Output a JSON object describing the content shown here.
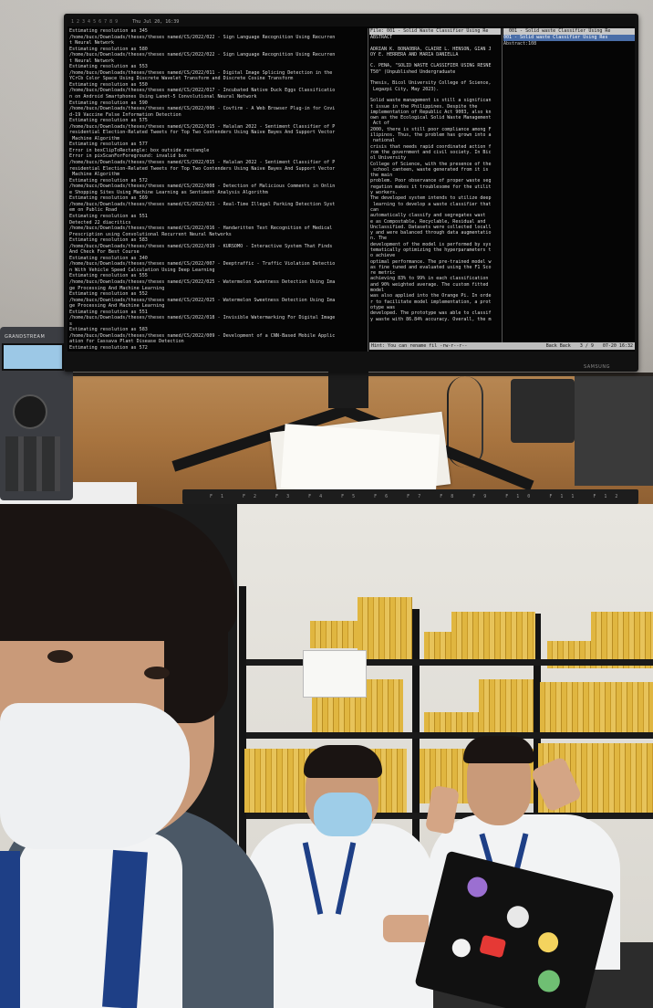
{
  "top_photo": {
    "phone_brand": "GRANDSTREAM",
    "monitor_brand": "SAMSUNG",
    "keyboard_keys": "F1 F2 F3 F4 F5 F6 F7 F8 F9 F10 F11 F12",
    "screen": {
      "workspaces": [
        "1",
        "2",
        "3",
        "4",
        "5",
        "6",
        "7",
        "8",
        "9"
      ],
      "active_workspace": "",
      "clock": "Thu Jul 20, 16:39",
      "terminal_lines": [
        "Estimating resolution as 345",
        "/home/bucs/Downloads/theses/theses named/CS/2022/022 - Sign Language Recognition Using Recurren",
        "t Neural Network",
        "Estimating resolution as 580",
        "/home/bucs/Downloads/theses/theses named/CS/2022/022 - Sign Language Recognition Using Recurren",
        "t Neural Network",
        "Estimating resolution as 553",
        "/home/bucs/Downloads/theses/theses named/CS/2022/011 - Digital Image Splicing Detection in the",
        "YCrCb Color Space Using Discrete Wavelet Transform and Discrete Cosine Transform",
        "Estimating resolution as 550",
        "/home/bucs/Downloads/theses/theses named/CS/2022/017 - Incubated Native Duck Eggs Classificatio",
        "n on Android Smartphones Using Lanet-5 Convolutional Neural Network",
        "Estimating resolution as 590",
        "/home/bucs/Downloads/theses/theses named/CS/2022/006 - Covfirm - A Web Browser Plug-in for Covi",
        "d-19 Vaccine False Information Detection",
        "Estimating resolution as 575",
        "/home/bucs/Downloads/theses/theses named/CS/2022/015 - Halalan 2022 - Sentiment Classifier of P",
        "residential Election-Related Tweets for Top Two Contenders Using Naive Bayes And Support Vector",
        " Machine Algorithm",
        "Estimating resolution as 577",
        "Error in boxClipToRectangle: box outside rectangle",
        "Error in pixScanForForeground: invalid box",
        "/home/bucs/Downloads/theses/theses named/CS/2022/015 - Halalan 2022 - Sentiment Classifier of P",
        "residential Election-Related Tweets for Top Two Contenders Using Naive Bayes And Support Vector",
        " Machine Algorithm",
        "Estimating resolution as 572",
        "/home/bucs/Downloads/theses/theses named/CS/2022/008 - Detection of Malicious Comments in Onlin",
        "e Shopping Sites Using Machine Learning as Sentiment Analysis Algorithm",
        "Estimating resolution as 569",
        "/home/bucs/Downloads/theses/theses named/CS/2022/021 - Real-Time Illegal Parking Detection Syst",
        "em on Public Road",
        "Estimating resolution as 551",
        "Detected 22 diacritics",
        "/home/bucs/Downloads/theses/theses named/CS/2022/016 - Handwritten Text Recognition of Medical",
        "Prescription using Convolutional Recurrent Neural Networks",
        "Estimating resolution as 583",
        "/home/bucs/Downloads/theses/theses named/CS/2022/019 - KURSOMO - Interactive System That Finds",
        "And Check For Best Course",
        "Estimating resolution as 340",
        "/home/bucs/Downloads/theses/theses named/CS/2022/007 - Deeptraffic - Traffic Violation Detectio",
        "n With Vehicle Speed Calculation Using Deep Learning",
        "Estimating resolution as 555",
        "/home/bucs/Downloads/theses/theses named/CS/2022/025 - Watermelon Sweetness Detection Using Ima",
        "ge Processing And Machine Learning",
        "Estimating resolution as 552",
        "/home/bucs/Downloads/theses/theses named/CS/2022/025 - Watermelon Sweetness Detection Using Ima",
        "ge Processing And Machine Learning",
        "Estimating resolution as 551",
        "/home/bucs/Downloads/theses/theses named/CS/2022/018 - Invisible Watermarking For Digital Image",
        "s",
        "Estimating resolution as 583",
        "/home/bucs/Downloads/theses/theses named/CS/2022/009 - Development of a CNN-Based Mobile Applic",
        "ation for Cassava Plant Disease Detection",
        "Estimating resolution as 572"
      ],
      "reader_header": "File: 001 - Solid Waste Classifier Using Re",
      "reader_lines": [
        "ABSTRACT",
        "",
        "ADRIAN K. BONAOBRA, CLAIRE L. HENSON, GIAN J",
        "OY E. HERRERA AND MARIA DANIELLA",
        "",
        "C. PEÑA, \"SOLID WASTE CLASSIFIER USING RESNE",
        "T50\" (Unpublished Undergraduate",
        "",
        "Thesis, Bicol University College of Science,",
        " Legazpi City, May 2023).",
        "",
        "Solid waste management is still a significan",
        "t issue in the Philippines. Despite the",
        "implementation of Republic Act 9003, also kn",
        "own as the Ecological Solid Waste Management",
        " Act of",
        "2000, there is still poor compliance among F",
        "ilipinos. Thus, the problem has grown into a",
        " national",
        "crisis that needs rapid coordinated action f",
        "rom the government and civil society. In Bic",
        "ol University",
        "College of Science, with the presence of the",
        " school canteen, waste generated from it is",
        "the main",
        "problem. Poor observance of proper waste seg",
        "regation makes it troublesome for the utilit",
        "y workers.",
        "The developed system intends to utilize deep",
        " learning to develop a waste classifier that",
        "can",
        "automatically classify and segregates wast",
        "e as Compostable, Recyclable, Residual and",
        "Unclassified. Datasets were collected locall",
        "y and were balanced through data augmentatio",
        "n. The",
        "development of the model is performed by sys",
        "tematically optimizing the hyperparameters t",
        "o achieve",
        "optimal performance. The pre-trained model w",
        "as fine tuned and evaluated using the F1 Sco",
        "re metric",
        "achieving 83% to 99% in each classification",
        "and 90% weighted average. The custom fitted",
        "model",
        "was also applied into the Orange Pi. In orde",
        "r to facilitate model implementation, a prot",
        "otype was",
        "developed. The prototype was able to classif",
        "y waste with 86.84% accuracy. Overall, the m"
      ],
      "toc_header": "  001 - Solid waste Classifier Using Re",
      "toc_selected": "001 - Solid waste Classifier Using Res",
      "toc_items": [
        "Abstract:108"
      ],
      "status_hint": "Hint: You can rename fil -rw-r--r--",
      "status_back": "Back Back",
      "status_page": "3 / 9",
      "status_time": "07-20 16:32"
    }
  },
  "bottom_photo": {
    "sign_lines": [
      "",
      "",
      ""
    ],
    "colors": {
      "books": "#e0b640",
      "lanyard": "#1e3f86",
      "wall": "#e3e0d9",
      "shelf": "#1a1a1a"
    }
  }
}
